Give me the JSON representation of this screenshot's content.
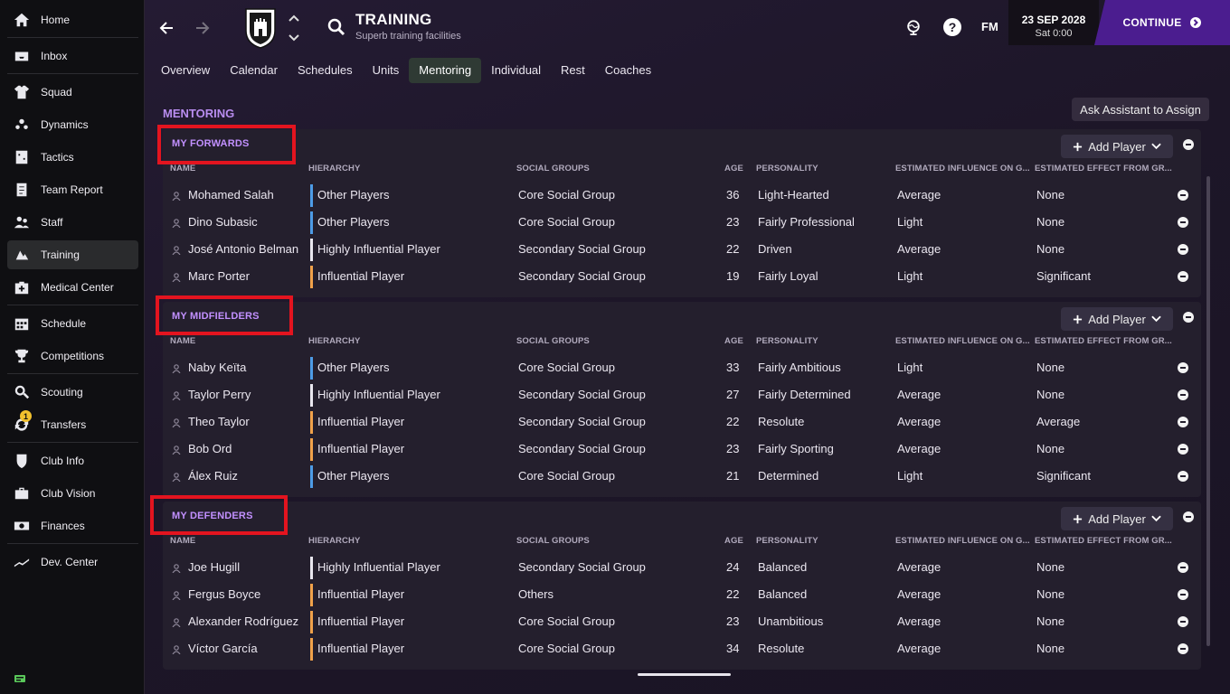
{
  "sidebar": {
    "items": [
      {
        "label": "Home",
        "icon": "home-icon"
      },
      {
        "label": "Inbox",
        "icon": "inbox-icon"
      },
      {
        "label": "Squad",
        "icon": "shirt-icon"
      },
      {
        "label": "Dynamics",
        "icon": "dynamics-icon"
      },
      {
        "label": "Tactics",
        "icon": "tactics-icon"
      },
      {
        "label": "Team Report",
        "icon": "report-icon"
      },
      {
        "label": "Staff",
        "icon": "staff-icon"
      },
      {
        "label": "Training",
        "icon": "training-icon"
      },
      {
        "label": "Medical Center",
        "icon": "medical-icon"
      },
      {
        "label": "Schedule",
        "icon": "calendar-icon"
      },
      {
        "label": "Competitions",
        "icon": "trophy-icon"
      },
      {
        "label": "Scouting",
        "icon": "scouting-icon"
      },
      {
        "label": "Transfers",
        "icon": "transfers-icon",
        "badge": "1"
      },
      {
        "label": "Club Info",
        "icon": "shield-icon"
      },
      {
        "label": "Club Vision",
        "icon": "briefcase-icon"
      },
      {
        "label": "Finances",
        "icon": "finances-icon"
      },
      {
        "label": "Dev. Center",
        "icon": "dev-center-icon"
      }
    ],
    "active": "Training"
  },
  "header": {
    "title": "TRAINING",
    "subtitle": "Superb training facilities",
    "fm_label": "FM",
    "date": "23 SEP 2028",
    "day_time": "Sat 0:00",
    "continue_label": "CONTINUE"
  },
  "tabs": [
    "Overview",
    "Calendar",
    "Schedules",
    "Units",
    "Mentoring",
    "Individual",
    "Rest",
    "Coaches"
  ],
  "active_tab": "Mentoring",
  "section_heading": "MENTORING",
  "ask_assistant_label": "Ask Assistant to Assign",
  "columns": {
    "name": "NAME",
    "hierarchy": "HIERARCHY",
    "social": "SOCIAL GROUPS",
    "age": "AGE",
    "personality": "PERSONALITY",
    "influence": "ESTIMATED INFLUENCE ON G...",
    "effect": "ESTIMATED EFFECT FROM GR..."
  },
  "add_player_label": "Add Player",
  "colors": {
    "other_players": "#4d9be6",
    "highly_influential": "#e8e6ee",
    "influential": "#f0a14a",
    "accent_purple": "#c290ff",
    "highlight_red": "#e3141f",
    "continue_bg": "#4b1d8f"
  },
  "groups": [
    {
      "title": "MY FORWARDS",
      "players": [
        {
          "name": "Mohamed Salah",
          "hierarchy": "Other Players",
          "tier": "other_players",
          "social": "Core Social Group",
          "age": "36",
          "personality": "Light-Hearted",
          "influence": "Average",
          "effect": "None"
        },
        {
          "name": "Dino Subasic",
          "hierarchy": "Other Players",
          "tier": "other_players",
          "social": "Core Social Group",
          "age": "23",
          "personality": "Fairly Professional",
          "influence": "Light",
          "effect": "None"
        },
        {
          "name": "José Antonio Belman",
          "hierarchy": "Highly Influential Player",
          "tier": "highly_influential",
          "social": "Secondary Social Group",
          "age": "22",
          "personality": "Driven",
          "influence": "Average",
          "effect": "None"
        },
        {
          "name": "Marc Porter",
          "hierarchy": "Influential Player",
          "tier": "influential",
          "social": "Secondary Social Group",
          "age": "19",
          "personality": "Fairly Loyal",
          "influence": "Light",
          "effect": "Significant"
        }
      ]
    },
    {
      "title": "MY MIDFIELDERS",
      "players": [
        {
          "name": "Naby Keïta",
          "hierarchy": "Other Players",
          "tier": "other_players",
          "social": "Core Social Group",
          "age": "33",
          "personality": "Fairly Ambitious",
          "influence": "Light",
          "effect": "None"
        },
        {
          "name": "Taylor Perry",
          "hierarchy": "Highly Influential Player",
          "tier": "highly_influential",
          "social": "Secondary Social Group",
          "age": "27",
          "personality": "Fairly Determined",
          "influence": "Average",
          "effect": "None"
        },
        {
          "name": "Theo Taylor",
          "hierarchy": "Influential Player",
          "tier": "influential",
          "social": "Secondary Social Group",
          "age": "22",
          "personality": "Resolute",
          "influence": "Average",
          "effect": "Average"
        },
        {
          "name": "Bob Ord",
          "hierarchy": "Influential Player",
          "tier": "influential",
          "social": "Secondary Social Group",
          "age": "23",
          "personality": "Fairly Sporting",
          "influence": "Average",
          "effect": "None"
        },
        {
          "name": "Álex Ruiz",
          "hierarchy": "Other Players",
          "tier": "other_players",
          "social": "Core Social Group",
          "age": "21",
          "personality": "Determined",
          "influence": "Light",
          "effect": "Significant"
        }
      ]
    },
    {
      "title": "MY DEFENDERS",
      "players": [
        {
          "name": "Joe Hugill",
          "hierarchy": "Highly Influential Player",
          "tier": "highly_influential",
          "social": "Secondary Social Group",
          "age": "24",
          "personality": "Balanced",
          "influence": "Average",
          "effect": "None"
        },
        {
          "name": "Fergus Boyce",
          "hierarchy": "Influential Player",
          "tier": "influential",
          "social": "Others",
          "age": "22",
          "personality": "Balanced",
          "influence": "Average",
          "effect": "None"
        },
        {
          "name": "Alexander Rodríguez",
          "hierarchy": "Influential Player",
          "tier": "influential",
          "social": "Core Social Group",
          "age": "23",
          "personality": "Unambitious",
          "influence": "Average",
          "effect": "None"
        },
        {
          "name": "Víctor García",
          "hierarchy": "Influential Player",
          "tier": "influential",
          "social": "Core Social Group",
          "age": "34",
          "personality": "Resolute",
          "influence": "Average",
          "effect": "None"
        }
      ]
    }
  ]
}
